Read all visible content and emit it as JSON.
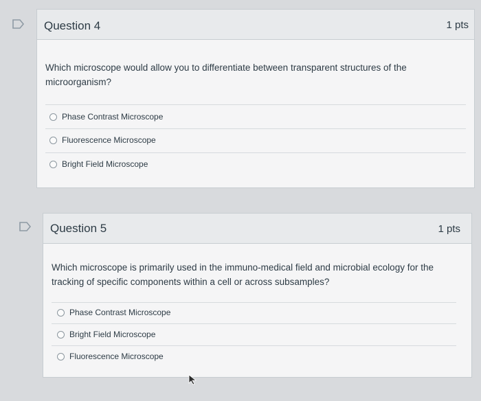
{
  "questions": [
    {
      "title": "Question 4",
      "points": "1 pts",
      "text": "Which microscope would allow you to differentiate between transparent structures of the microorganism?",
      "answers": [
        "Phase Contrast Microscope",
        "Fluorescence Microscope",
        "Bright Field Microscope"
      ]
    },
    {
      "title": "Question 5",
      "points": "1 pts",
      "text": "Which microscope is primarily used in the immuno-medical field and microbial ecology for the tracking of specific components within a cell or across subsamples?",
      "answers": [
        "Phase Contrast Microscope",
        "Bright Field Microscope",
        "Fluorescence Microscope"
      ]
    }
  ],
  "colors": {
    "flag": "#8e9aa4",
    "background": "#d8dadd",
    "card": "#f5f5f6",
    "header": "#e8eaec"
  },
  "icons": {
    "flag": "flag-question-icon",
    "radio": "radio-button",
    "cursor": "mouse-pointer-icon"
  }
}
